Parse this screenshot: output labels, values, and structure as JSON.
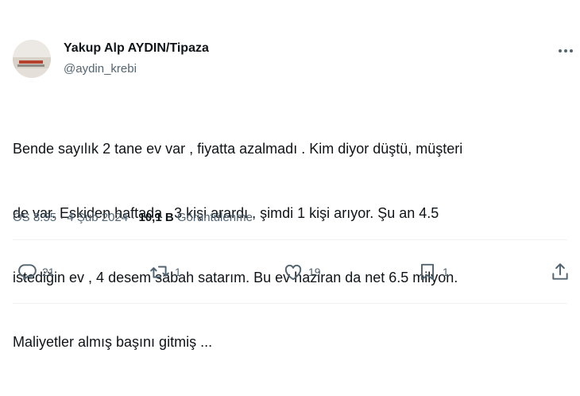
{
  "author": {
    "name": "Yakup Alp AYDIN/Tipaza",
    "handle": "@aydin_krebi"
  },
  "tweet": {
    "lines": [
      "Bende sayılık 2 tane ev var , fiyatta azalmadı . Kim diyor düştü, müşteri",
      "de var. Eskiden haftada   3 kişi arardı , şimdi 1 kişi arıyor. Şu an 4.5",
      "istediğin ev , 4 desem sabah satarım. Bu ev haziran da net 6.5 milyon.",
      "Maliyetler almış başını gitmiş ..."
    ]
  },
  "meta": {
    "time": "ÖS 8:55",
    "sep1": " · ",
    "date": "4 Şub 2024",
    "sep2": " · ",
    "views_count": "10,1 B",
    "views_label": " Görüntülenme"
  },
  "actions": {
    "reply_count": "21",
    "retweet_count": "1",
    "like_count": "19",
    "bookmark_count": "1"
  },
  "icons": {
    "more": "more-dots-icon",
    "reply": "reply-icon",
    "retweet": "retweet-icon",
    "like": "heart-icon",
    "bookmark": "bookmark-icon",
    "share": "share-icon"
  },
  "colors": {
    "text": "#0f1419",
    "secondary": "#536471",
    "divider": "#eff3f4"
  }
}
